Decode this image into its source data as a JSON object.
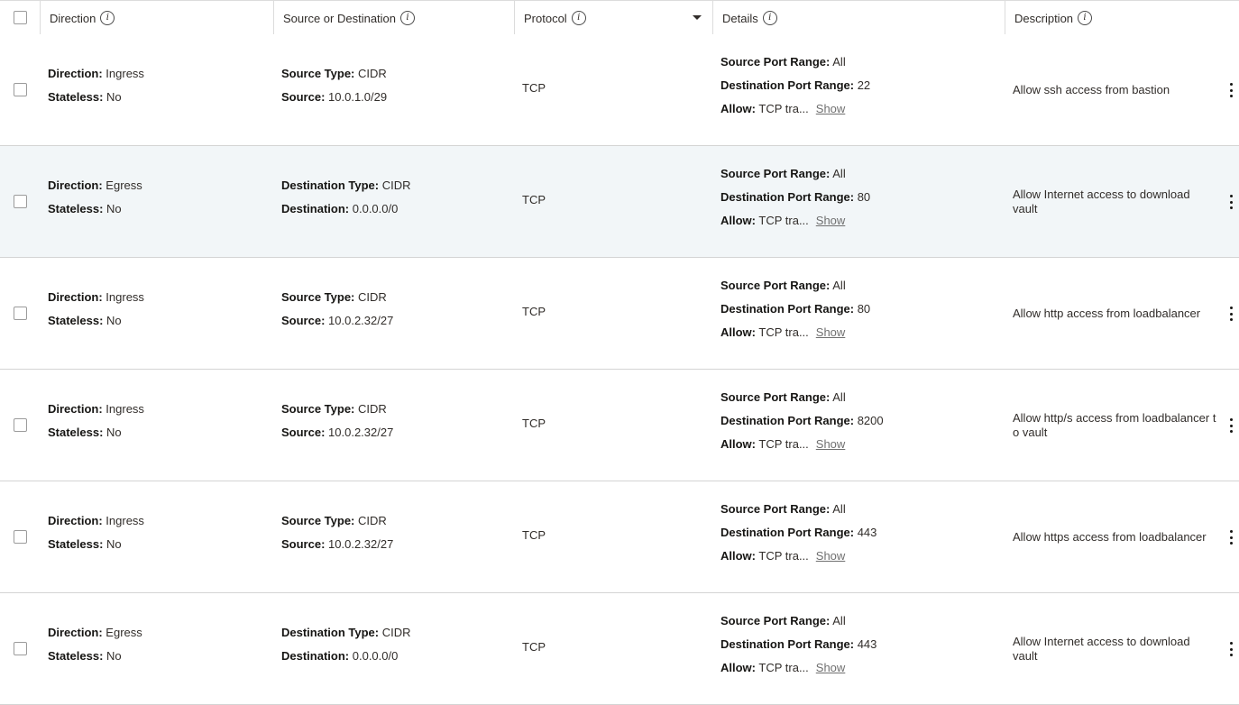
{
  "header": {
    "direction": "Direction",
    "source_or_destination": "Source or Destination",
    "protocol": "Protocol",
    "details": "Details",
    "description": "Description",
    "info_glyph": "i"
  },
  "labels": {
    "direction": "Direction:",
    "stateless": "Stateless:",
    "source_type": "Source Type:",
    "source": "Source:",
    "destination_type": "Destination Type:",
    "destination": "Destination:",
    "source_port_range": "Source Port Range:",
    "destination_port_range": "Destination Port Range:",
    "allow": "Allow:",
    "show": "Show"
  },
  "rows": [
    {
      "direction": "Ingress",
      "stateless": "No",
      "target_kind": "source",
      "target_type": "CIDR",
      "target": "10.0.1.0/29",
      "protocol": "TCP",
      "source_port_range": "All",
      "destination_port_range": "22",
      "allow": "TCP tra...",
      "description": "Allow ssh access from bastion"
    },
    {
      "direction": "Egress",
      "stateless": "No",
      "target_kind": "destination",
      "target_type": "CIDR",
      "target": "0.0.0.0/0",
      "protocol": "TCP",
      "source_port_range": "All",
      "destination_port_range": "80",
      "allow": "TCP tra...",
      "description": "Allow Internet access to download vault"
    },
    {
      "direction": "Ingress",
      "stateless": "No",
      "target_kind": "source",
      "target_type": "CIDR",
      "target": "10.0.2.32/27",
      "protocol": "TCP",
      "source_port_range": "All",
      "destination_port_range": "80",
      "allow": "TCP tra...",
      "description": "Allow http access from loadbalancer"
    },
    {
      "direction": "Ingress",
      "stateless": "No",
      "target_kind": "source",
      "target_type": "CIDR",
      "target": "10.0.2.32/27",
      "protocol": "TCP",
      "source_port_range": "All",
      "destination_port_range": "8200",
      "allow": "TCP tra...",
      "description": "Allow http/s access from loadbalancer t o vault"
    },
    {
      "direction": "Ingress",
      "stateless": "No",
      "target_kind": "source",
      "target_type": "CIDR",
      "target": "10.0.2.32/27",
      "protocol": "TCP",
      "source_port_range": "All",
      "destination_port_range": "443",
      "allow": "TCP tra...",
      "description": "Allow https access from loadbalancer"
    },
    {
      "direction": "Egress",
      "stateless": "No",
      "target_kind": "destination",
      "target_type": "CIDR",
      "target": "0.0.0.0/0",
      "protocol": "TCP",
      "source_port_range": "All",
      "destination_port_range": "443",
      "allow": "TCP tra...",
      "description": "Allow Internet access to download vault"
    }
  ],
  "highlighted_row_index": 1,
  "colors": {
    "highlight_row": "#f2f6f8",
    "border": "#d4d4d4",
    "text": "#312d2a",
    "link": "#6f6f6f"
  }
}
